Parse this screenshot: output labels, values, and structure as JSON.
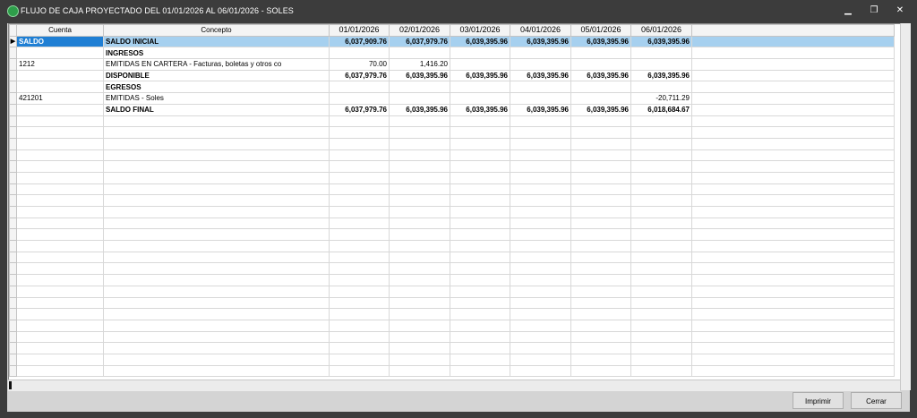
{
  "window": {
    "title": "FLUJO DE CAJA PROYECTADO DEL 01/01/2026 AL 06/01/2026  -  SOLES",
    "minimize_glyph": "▁",
    "restore_glyph": "❐",
    "close_glyph": "✕"
  },
  "table": {
    "columns": [
      "Cuenta",
      "Concepto",
      "01/01/2026",
      "02/01/2026",
      "03/01/2026",
      "04/01/2026",
      "05/01/2026",
      "06/01/2026"
    ],
    "current_row_marker": "▶",
    "rows": [
      {
        "cuenta": "SALDO",
        "concepto": "SALDO INICIAL",
        "values": [
          "6,037,909.76",
          "6,037,979.76",
          "6,039,395.96",
          "6,039,395.96",
          "6,039,395.96",
          "6,039,395.96"
        ],
        "bold": true,
        "selected": true
      },
      {
        "cuenta": "",
        "concepto": "INGRESOS",
        "values": [
          "",
          "",
          "",
          "",
          "",
          ""
        ],
        "bold": true,
        "selected": false
      },
      {
        "cuenta": "1212",
        "concepto": "EMITIDAS EN CARTERA - Facturas, boletas y otros co",
        "values": [
          "70.00",
          "1,416.20",
          "",
          "",
          "",
          ""
        ],
        "bold": false,
        "selected": false
      },
      {
        "cuenta": "",
        "concepto": "DISPONIBLE",
        "values": [
          "6,037,979.76",
          "6,039,395.96",
          "6,039,395.96",
          "6,039,395.96",
          "6,039,395.96",
          "6,039,395.96"
        ],
        "bold": true,
        "selected": false
      },
      {
        "cuenta": "",
        "concepto": "EGRESOS",
        "values": [
          "",
          "",
          "",
          "",
          "",
          ""
        ],
        "bold": true,
        "selected": false
      },
      {
        "cuenta": "421201",
        "concepto": "EMITIDAS - Soles",
        "values": [
          "",
          "",
          "",
          "",
          "",
          "-20,711.29"
        ],
        "bold": false,
        "selected": false
      },
      {
        "cuenta": "",
        "concepto": "SALDO FINAL",
        "values": [
          "6,037,979.76",
          "6,039,395.96",
          "6,039,395.96",
          "6,039,395.96",
          "6,039,395.96",
          "6,018,684.67"
        ],
        "bold": true,
        "selected": false
      }
    ]
  },
  "buttons": {
    "print_label": "Imprimir",
    "close_label": "Cerrar"
  }
}
